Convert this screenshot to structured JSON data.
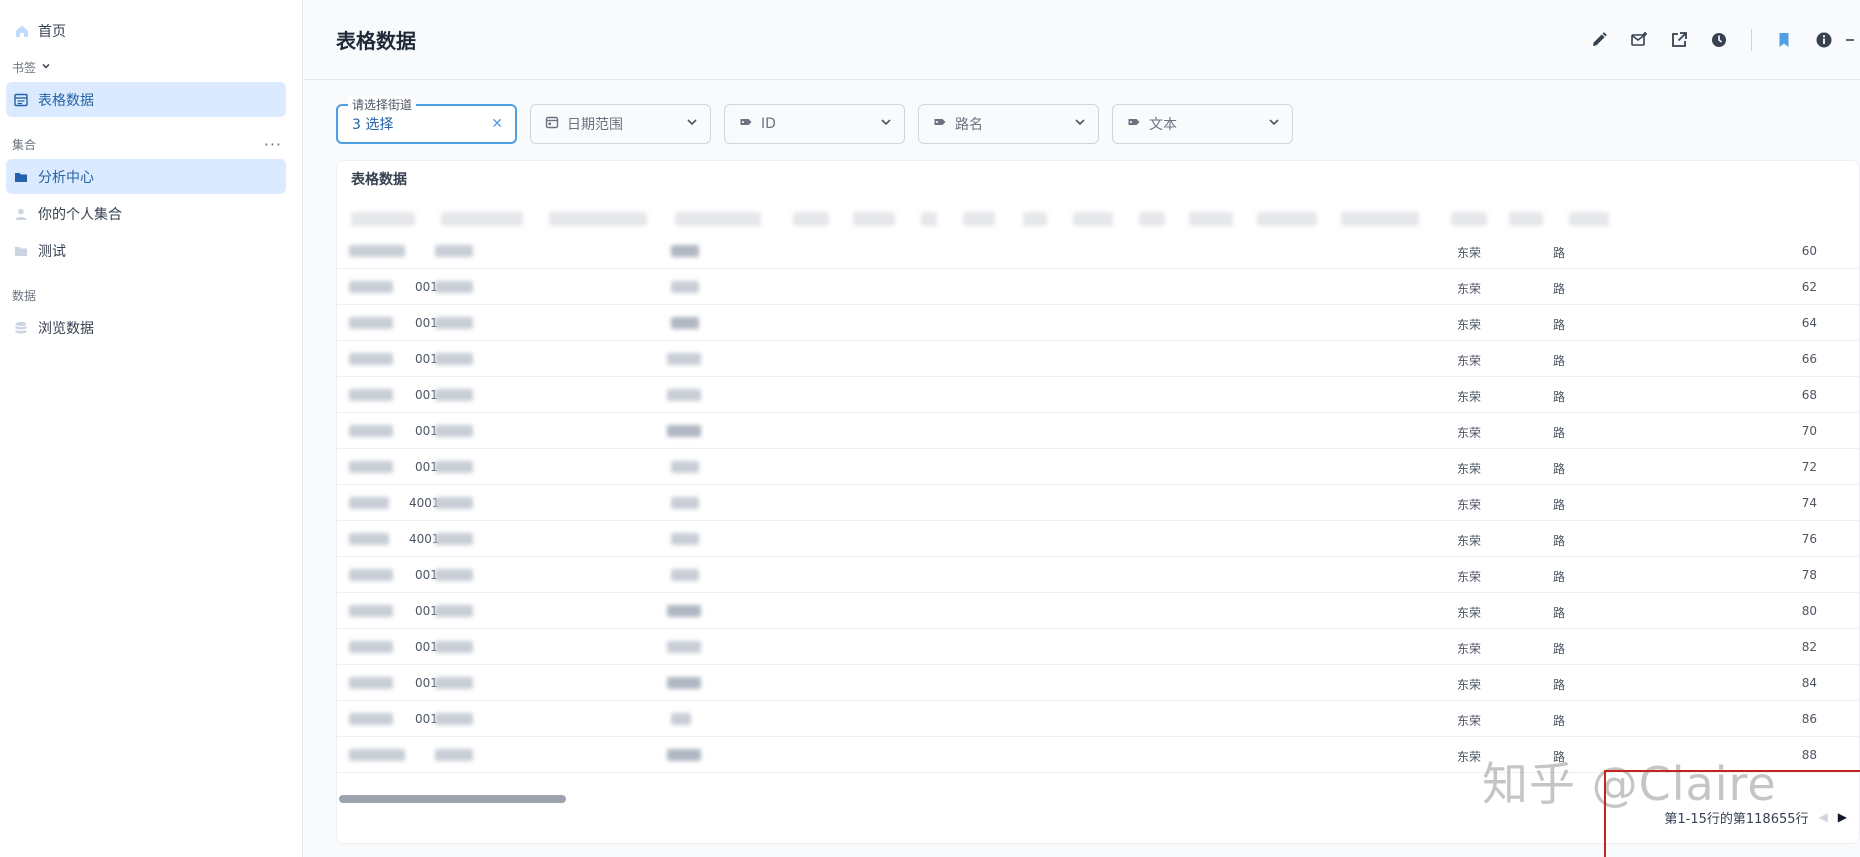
{
  "sidebar": {
    "home_label": "首页",
    "bookmarks_section": "书签",
    "bookmark_items": [
      {
        "label": "表格数据"
      }
    ],
    "collections_section": "集合",
    "collection_items": [
      {
        "label": "分析中心"
      },
      {
        "label": "你的个人集合"
      },
      {
        "label": "测试"
      }
    ],
    "data_section": "数据",
    "data_items": [
      {
        "label": "浏览数据"
      }
    ]
  },
  "header": {
    "title": "表格数据",
    "toolbar_icons": [
      "edit-icon",
      "subscribe-icon",
      "share-icon",
      "history-icon",
      "bookmark-icon",
      "info-icon"
    ]
  },
  "filters": [
    {
      "legend": "请选择街道",
      "value": "3 选择",
      "icon": "close-icon"
    },
    {
      "label": "日期范围",
      "icon": "calendar-icon"
    },
    {
      "label": "ID",
      "icon": "tag-icon"
    },
    {
      "label": "路名",
      "icon": "tag-icon"
    },
    {
      "label": "文本",
      "icon": "tag-icon"
    }
  ],
  "table": {
    "title": "表格数据",
    "rows": [
      {
        "id": "",
        "district": "东荣",
        "road": "路",
        "num": "60"
      },
      {
        "id": "001",
        "district": "东荣",
        "road": "路",
        "num": "62"
      },
      {
        "id": "001",
        "district": "东荣",
        "road": "路",
        "num": "64"
      },
      {
        "id": "001",
        "district": "东荣",
        "road": "路",
        "num": "66"
      },
      {
        "id": "001",
        "district": "东荣",
        "road": "路",
        "num": "68"
      },
      {
        "id": "001",
        "district": "东荣",
        "road": "路",
        "num": "70"
      },
      {
        "id": "001",
        "district": "东荣",
        "road": "路",
        "num": "72"
      },
      {
        "id": "4001",
        "district": "东荣",
        "road": "路",
        "num": "74"
      },
      {
        "id": "4001",
        "district": "东荣",
        "road": "路",
        "num": "76"
      },
      {
        "id": "001",
        "district": "东荣",
        "road": "路",
        "num": "78"
      },
      {
        "id": "001",
        "district": "东荣",
        "road": "路",
        "num": "80"
      },
      {
        "id": "001",
        "district": "东荣",
        "road": "路",
        "num": "82"
      },
      {
        "id": "001",
        "district": "东荣",
        "road": "路",
        "num": "84"
      },
      {
        "id": "001",
        "district": "东荣",
        "road": "路",
        "num": "86"
      },
      {
        "id": "",
        "district": "东荣",
        "road": "路",
        "num": "88"
      }
    ],
    "pagination": "第1-15行的第118655行"
  },
  "watermark": "知乎 @Claire",
  "colors": {
    "accent": "#509ee3",
    "active_bg": "#dbeafe",
    "highlight_box": "#c0261f"
  }
}
